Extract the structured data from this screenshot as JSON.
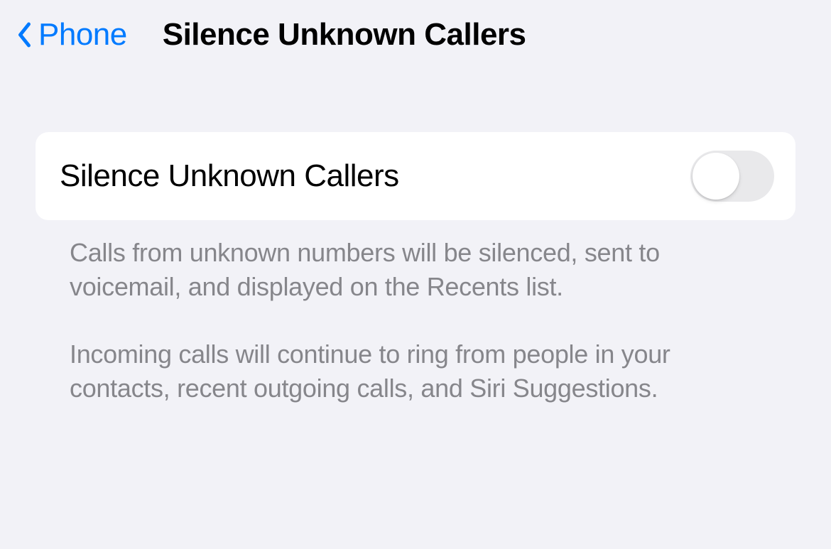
{
  "nav": {
    "back_label": "Phone",
    "title": "Silence Unknown Callers"
  },
  "setting": {
    "label": "Silence Unknown Callers",
    "enabled": false
  },
  "footer": {
    "paragraph1": "Calls from unknown numbers will be silenced, sent to voicemail, and displayed on the Recents list.",
    "paragraph2": "Incoming calls will continue to ring from people in your contacts, recent outgoing calls, and Siri Suggestions."
  },
  "colors": {
    "accent": "#007aff",
    "background": "#f2f2f7",
    "cell": "#ffffff",
    "secondaryText": "#86868b",
    "toggleOff": "#e9e9eb"
  }
}
